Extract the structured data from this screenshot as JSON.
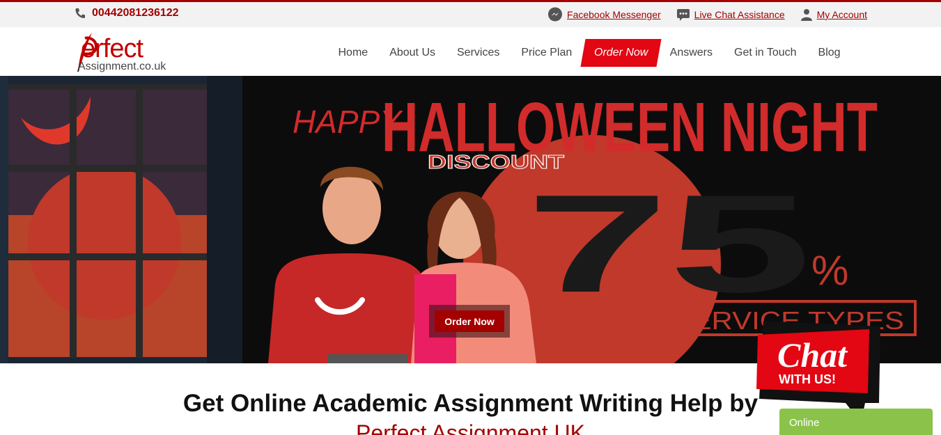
{
  "topbar": {
    "phone": "00442081236122",
    "links": [
      {
        "label": "Facebook Messenger",
        "icon": "messenger-icon"
      },
      {
        "label": "Live Chat Assistance",
        "icon": "chat-bubble-icon"
      },
      {
        "label": "My Account",
        "icon": "user-icon"
      }
    ]
  },
  "logo": {
    "title": "erfect",
    "subtitle": "Assignment.co.uk"
  },
  "nav": {
    "items": [
      "Home",
      "About Us",
      "Services",
      "Price Plan",
      "Order Now",
      "Answers",
      "Get in Touch",
      "Blog"
    ],
    "active": "Order Now"
  },
  "hero": {
    "happy": "HAPPY",
    "headline": "HALLOWEEN NIGHT",
    "discount": "DISCOUNT",
    "percent": "75",
    "percent_sign": "%",
    "tagline": "ON ALL SERVICE TYPES",
    "button": "Order Now"
  },
  "intro": {
    "heading": "Get Online Academic Assignment Writing Help by",
    "subheading": "Perfect Assignment UK"
  },
  "chat_widget": {
    "line1": "Chat",
    "line2": "WITH US!",
    "status": "Online"
  },
  "colors": {
    "brand": "#a40000",
    "accent": "#e30613",
    "online": "#8bc34a"
  }
}
